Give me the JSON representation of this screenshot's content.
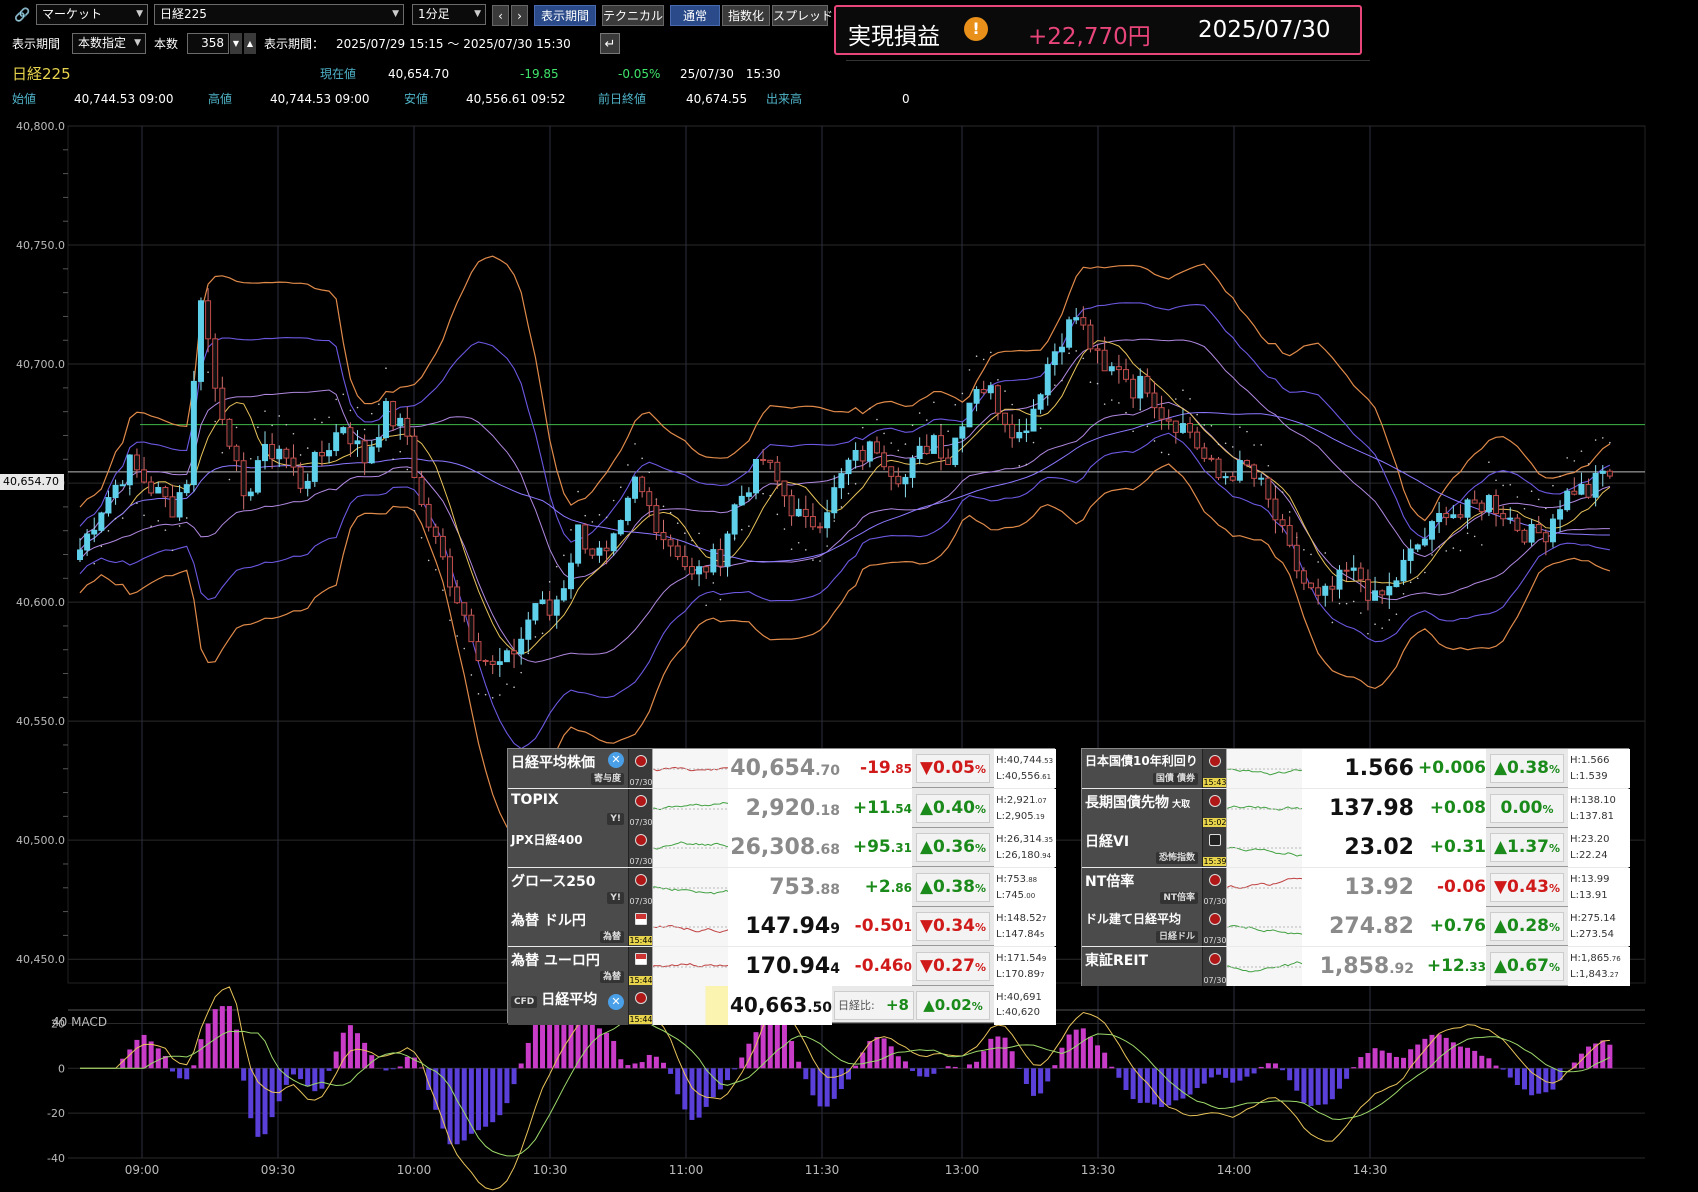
{
  "toolbar": {
    "market_select": "マーケット",
    "symbol_select": "日経225",
    "interval_select": "1分足",
    "btn_display_period": "表示期間",
    "btn_technical": "テクニカル",
    "btn_normal": "通常",
    "btn_index": "指数化",
    "btn_spread": "スプレッド",
    "period_label": "表示期間",
    "period_mode": "本数指定",
    "bars_label": "本数",
    "bars_value": "358",
    "range_label": "表示期間：",
    "range_value": "2025/07/29 15:15 ～ 2025/07/30 15:30"
  },
  "pnl": {
    "label": "実現損益",
    "value": "+22,770円",
    "date": "2025/07/30"
  },
  "quote": {
    "name": "日経225",
    "current_label": "現在値",
    "current": "40,654.70",
    "change": "-19.85",
    "change_pct": "-0.05%",
    "datetime": "25/07/30　15:30",
    "open_label": "始値",
    "open": "40,744.53 09:00",
    "high_label": "高値",
    "high": "40,744.53 09:00",
    "low_label": "安値",
    "low": "40,556.61 09:52",
    "prev_label": "前日終値",
    "prev": "40,674.55",
    "volume_label": "出来高",
    "volume": "0"
  },
  "chart_data": {
    "type": "candlestick",
    "y_ticks": [
      "40,800.0",
      "40,750.0",
      "40,700.0",
      "40,650.0",
      "40,600.0",
      "40,550.0",
      "40,500.0",
      "40,450.0"
    ],
    "ylim": [
      40440,
      40800
    ],
    "x_ticks": [
      "09:00",
      "09:30",
      "10:00",
      "10:30",
      "11:00",
      "11:30",
      "13:00",
      "13:30",
      "14:00",
      "14:30"
    ],
    "current_price_tag": "40,654.70",
    "prev_close_line": 40674.55,
    "close_path": [
      [
        0,
        40622
      ],
      [
        3,
        40640
      ],
      [
        7,
        40658
      ],
      [
        10,
        40648
      ],
      [
        13,
        40640
      ],
      [
        15,
        40652
      ],
      [
        17,
        40730
      ],
      [
        19,
        40690
      ],
      [
        21,
        40670
      ],
      [
        23,
        40640
      ],
      [
        25,
        40660
      ],
      [
        28,
        40665
      ],
      [
        31,
        40650
      ],
      [
        34,
        40662
      ],
      [
        37,
        40675
      ],
      [
        40,
        40660
      ],
      [
        43,
        40680
      ],
      [
        46,
        40670
      ],
      [
        48,
        40640
      ],
      [
        50,
        40625
      ],
      [
        52,
        40610
      ],
      [
        54,
        40595
      ],
      [
        56,
        40580
      ],
      [
        58,
        40572
      ],
      [
        60,
        40575
      ],
      [
        62,
        40585
      ],
      [
        64,
        40600
      ],
      [
        66,
        40595
      ],
      [
        68,
        40608
      ],
      [
        70,
        40630
      ],
      [
        72,
        40622
      ],
      [
        74,
        40618
      ],
      [
        76,
        40630
      ],
      [
        78,
        40650
      ],
      [
        80,
        40640
      ],
      [
        82,
        40628
      ],
      [
        84,
        40622
      ],
      [
        86,
        40610
      ],
      [
        88,
        40615
      ],
      [
        90,
        40620
      ],
      [
        92,
        40640
      ],
      [
        94,
        40650
      ],
      [
        96,
        40660
      ],
      [
        98,
        40650
      ],
      [
        100,
        40640
      ],
      [
        102,
        40632
      ],
      [
        104,
        40636
      ],
      [
        106,
        40646
      ],
      [
        108,
        40658
      ],
      [
        110,
        40662
      ],
      [
        112,
        40666
      ],
      [
        114,
        40657
      ],
      [
        116,
        40652
      ],
      [
        118,
        40662
      ],
      [
        120,
        40670
      ],
      [
        122,
        40660
      ],
      [
        124,
        40678
      ],
      [
        126,
        40692
      ],
      [
        128,
        40688
      ],
      [
        130,
        40678
      ],
      [
        132,
        40670
      ],
      [
        134,
        40682
      ],
      [
        136,
        40700
      ],
      [
        138,
        40712
      ],
      [
        140,
        40720
      ],
      [
        142,
        40708
      ],
      [
        144,
        40695
      ],
      [
        146,
        40700
      ],
      [
        148,
        40690
      ],
      [
        150,
        40692
      ],
      [
        152,
        40680
      ],
      [
        154,
        40676
      ],
      [
        156,
        40672
      ],
      [
        158,
        40660
      ],
      [
        160,
        40652
      ],
      [
        162,
        40655
      ],
      [
        164,
        40656
      ],
      [
        166,
        40648
      ],
      [
        168,
        40635
      ],
      [
        170,
        40620
      ],
      [
        172,
        40608
      ],
      [
        174,
        40600
      ],
      [
        176,
        40605
      ],
      [
        178,
        40612
      ],
      [
        180,
        40610
      ],
      [
        182,
        40600
      ],
      [
        184,
        40605
      ],
      [
        186,
        40615
      ],
      [
        188,
        40624
      ],
      [
        190,
        40630
      ],
      [
        192,
        40640
      ],
      [
        194,
        40636
      ],
      [
        196,
        40640
      ],
      [
        198,
        40643
      ],
      [
        200,
        40638
      ],
      [
        202,
        40632
      ],
      [
        204,
        40628
      ],
      [
        206,
        40630
      ],
      [
        208,
        40642
      ],
      [
        210,
        40648
      ],
      [
        212,
        40646
      ],
      [
        214,
        40654
      ]
    ],
    "macd": {
      "label": "40 MACD",
      "y_ticks": [
        "20",
        "0",
        "-20",
        "-40"
      ],
      "ylim": [
        -40,
        26
      ]
    }
  },
  "panel_left": [
    {
      "name": "日経平均株価",
      "sub": "寄与度",
      "date": "07/30",
      "value": "40,654",
      "value_dec": ".70",
      "change": "-19",
      "change_dec": ".85",
      "pct": "▼0.05",
      "dir": "dn",
      "high": "H:40,744",
      "high_dec": ".53",
      "low": "L:40,556",
      "low_dec": ".61",
      "value_grey": true,
      "x_badge": true
    },
    {
      "name": "TOPIX",
      "sub": "Y!",
      "date": "07/30",
      "value": "2,920",
      "value_dec": ".18",
      "change": "+11",
      "change_dec": ".54",
      "pct": "▲0.40",
      "dir": "up",
      "high": "H:2,921",
      "high_dec": ".07",
      "low": "L:2,905",
      "low_dec": ".19",
      "value_grey": true
    },
    {
      "name": "JPX日経400",
      "sub": "",
      "date": "07/30",
      "value": "26,308",
      "value_dec": ".68",
      "change": "+95",
      "change_dec": ".31",
      "pct": "▲0.36",
      "dir": "up",
      "high": "H:26,314",
      "high_dec": ".35",
      "low": "L:26,180",
      "low_dec": ".94",
      "value_grey": true
    },
    {
      "name": "グロース250",
      "sub": "Y!",
      "date": "07/30",
      "value": "753",
      "value_dec": ".88",
      "change": "+2",
      "change_dec": ".86",
      "pct": "▲0.38",
      "dir": "up",
      "high": "H:753",
      "high_dec": ".88",
      "low": "L:745",
      "low_dec": ".00",
      "value_grey": true
    },
    {
      "name": "為替 ドル円",
      "sub": "為替",
      "date": "15:44",
      "value": "147.94",
      "value_dec": "9",
      "change": "-0.50",
      "change_dec": "1",
      "pct": "▼0.34",
      "dir": "dn",
      "high": "H:148.52",
      "high_dec": "7",
      "low": "L:147.84",
      "low_dec": "5",
      "value_grey": false,
      "us": true
    },
    {
      "name": "為替 ユーロ円",
      "sub": "為替",
      "date": "15:44",
      "value": "170.94",
      "value_dec": "4",
      "change": "-0.46",
      "change_dec": "0",
      "pct": "▼0.27",
      "dir": "dn",
      "high": "H:171.54",
      "high_dec": "9",
      "low": "L:170.89",
      "low_dec": "7",
      "value_grey": false,
      "us": true
    }
  ],
  "panel_cfd": {
    "badge": "CFD",
    "name": "日経平均",
    "date": "15:44",
    "value": "40,663",
    "value_dec": ".50",
    "diff_label": "日経比:",
    "diff": "+8",
    "pct": "▲0.02",
    "high": "H:40,691",
    "low": "L:40,620"
  },
  "panel_right": [
    {
      "name": "日本国債10年利回り",
      "sub": "国債 債券",
      "date": "15:43",
      "value": "1.566",
      "value_dec": "",
      "change": "+0.006",
      "change_dec": "",
      "pct": "▲0.38",
      "dir": "up",
      "high": "H:1.566",
      "high_dec": "",
      "low": "L:1.539",
      "low_dec": "",
      "value_grey": false
    },
    {
      "name": "長期国債先物",
      "name_tag": "大取",
      "sub": "",
      "date": "15:02",
      "value": "137.98",
      "value_dec": "",
      "change": "+0.08",
      "change_dec": "",
      "pct": "0.00",
      "dir": "flat",
      "high": "H:138.10",
      "high_dec": "",
      "low": "L:137.81",
      "low_dec": "",
      "value_grey": false
    },
    {
      "name": "日経VI",
      "sub": "恐怖指数",
      "date": "15:39",
      "value": "23.02",
      "value_dec": "",
      "change": "+0.31",
      "change_dec": "",
      "pct": "▲1.37",
      "dir": "up",
      "high": "H:23.20",
      "high_dec": "",
      "low": "L:22.24",
      "low_dec": "",
      "value_grey": false,
      "ghost": true
    },
    {
      "name": "NT倍率",
      "sub": "NT倍率",
      "date": "07/30",
      "value": "13.92",
      "value_dec": "",
      "change": "-0.06",
      "change_dec": "",
      "pct": "▼0.43",
      "dir": "dn",
      "high": "H:13.99",
      "high_dec": "",
      "low": "L:13.91",
      "low_dec": "",
      "value_grey": true
    },
    {
      "name": "ドル建て日経平均",
      "sub": "日経ドル",
      "date": "07/30",
      "value": "274.82",
      "value_dec": "",
      "change": "+0.76",
      "change_dec": "",
      "pct": "▲0.28",
      "dir": "up",
      "high": "H:275.14",
      "high_dec": "",
      "low": "L:273.54",
      "low_dec": "",
      "value_grey": true
    },
    {
      "name": "東証REIT",
      "sub": "",
      "date": "07/30",
      "value": "1,858",
      "value_dec": ".92",
      "change": "+12",
      "change_dec": ".33",
      "pct": "▲0.67",
      "dir": "up",
      "high": "H:1,865",
      "high_dec": ".76",
      "low": "L:1,843",
      "low_dec": ".27",
      "value_grey": true
    }
  ],
  "colors": {
    "candle": "#5fd0ea",
    "candle_down": "#c24a4a",
    "band_outer": "#e08a4a",
    "band_mid": "#6a58e0",
    "ma": "#e8c35a",
    "pnl_border": "#e8457a",
    "pnl_value": "#e8457a",
    "prevclose": "#3fb84a"
  }
}
